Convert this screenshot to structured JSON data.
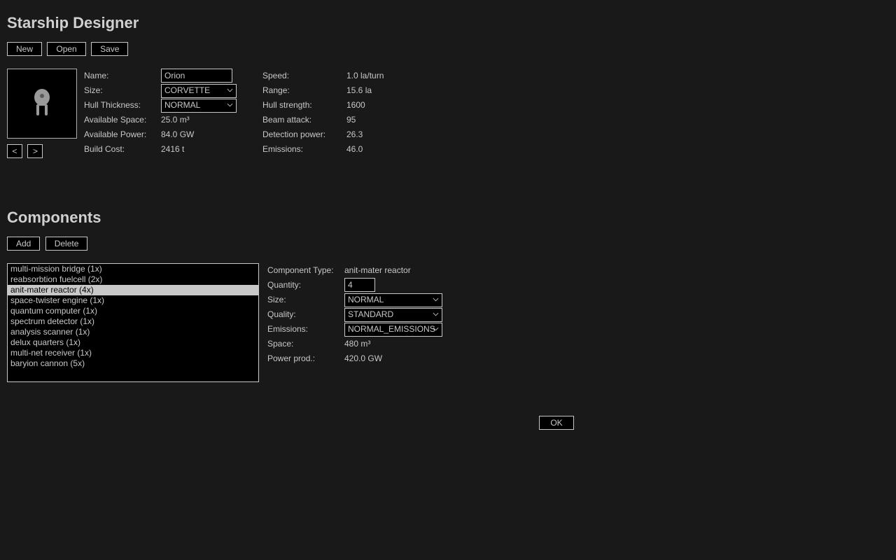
{
  "header": {
    "title": "Starship Designer"
  },
  "toolbar": {
    "new": "New",
    "open": "Open",
    "save": "Save"
  },
  "preview": {
    "prev": "<",
    "next": ">"
  },
  "ship": {
    "labels": {
      "name": "Name:",
      "size": "Size:",
      "hull_thickness": "Hull Thickness:",
      "available_space": "Available Space:",
      "available_power": "Available Power:",
      "build_cost": "Build Cost:"
    },
    "values": {
      "name": "Orion",
      "size": "CORVETTE",
      "hull_thickness": "NORMAL",
      "available_space": "25.0 m³",
      "available_power": "84.0 GW",
      "build_cost": "2416 t"
    },
    "derived_labels": {
      "speed": "Speed:",
      "range": "Range:",
      "hull_strength": "Hull strength:",
      "beam_attack": "Beam attack:",
      "detection_power": "Detection power:",
      "emissions": "Emissions:"
    },
    "derived_values": {
      "speed": "1.0 la/turn",
      "range": "15.6 la",
      "hull_strength": "1600",
      "beam_attack": "95",
      "detection_power": "26.3",
      "emissions": "46.0"
    }
  },
  "components": {
    "title": "Components",
    "toolbar": {
      "add": "Add",
      "delete": "Delete"
    },
    "items": [
      "multi-mission bridge (1x)",
      "reabsorbtion fuelcell (2x)",
      "anit-mater reactor (4x)",
      "space-twister engine (1x)",
      "quantum computer (1x)",
      "spectrum detector (1x)",
      "analysis scanner (1x)",
      "delux quarters (1x)",
      "multi-net receiver (1x)",
      "baryion cannon (5x)"
    ],
    "selected_index": 2,
    "detail": {
      "labels": {
        "type": "Component Type:",
        "quantity": "Quantity:",
        "size": "Size:",
        "quality": "Quality:",
        "emissions": "Emissions:",
        "space": "Space:",
        "power_prod": "Power prod.:"
      },
      "values": {
        "type": "anit-mater reactor",
        "quantity": "4",
        "size": "NORMAL",
        "quality": "STANDARD",
        "emissions": "NORMAL_EMISSIONS",
        "space": "480 m³",
        "power_prod": "420.0 GW"
      }
    }
  },
  "footer": {
    "ok": "OK"
  }
}
